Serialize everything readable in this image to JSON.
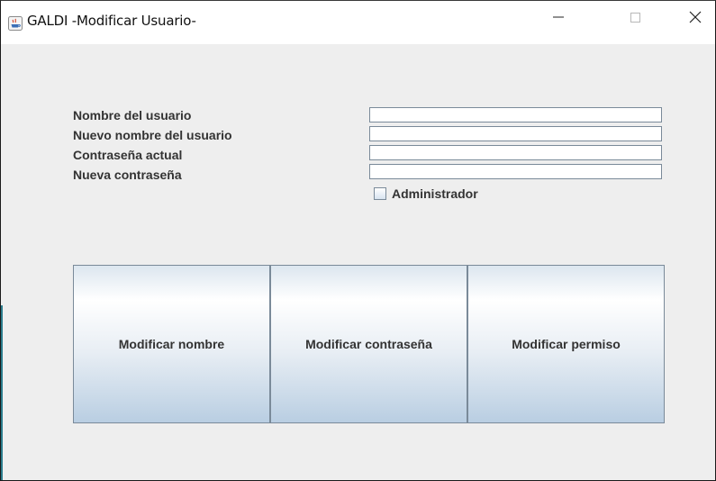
{
  "window": {
    "title": "GALDI -Modificar Usuario-",
    "controls": {
      "minimize": "—",
      "maximize": "□",
      "close": "✕"
    }
  },
  "form": {
    "labels": {
      "username": "Nombre del usuario",
      "new_username": "Nuevo nombre del usuario",
      "current_password": "Contraseña actual",
      "new_password": "Nueva contraseña"
    },
    "values": {
      "username": "",
      "new_username": "",
      "current_password": "",
      "new_password": ""
    },
    "admin_checkbox": {
      "label": "Administrador",
      "checked": false
    }
  },
  "actions": {
    "modify_name": "Modificar nombre",
    "modify_password": "Modificar contraseña",
    "modify_permission": "Modificar permiso"
  },
  "colors": {
    "button_top": "#ffffff",
    "button_bottom": "#b9cee2",
    "accent_strip": "#2b7c8c"
  }
}
